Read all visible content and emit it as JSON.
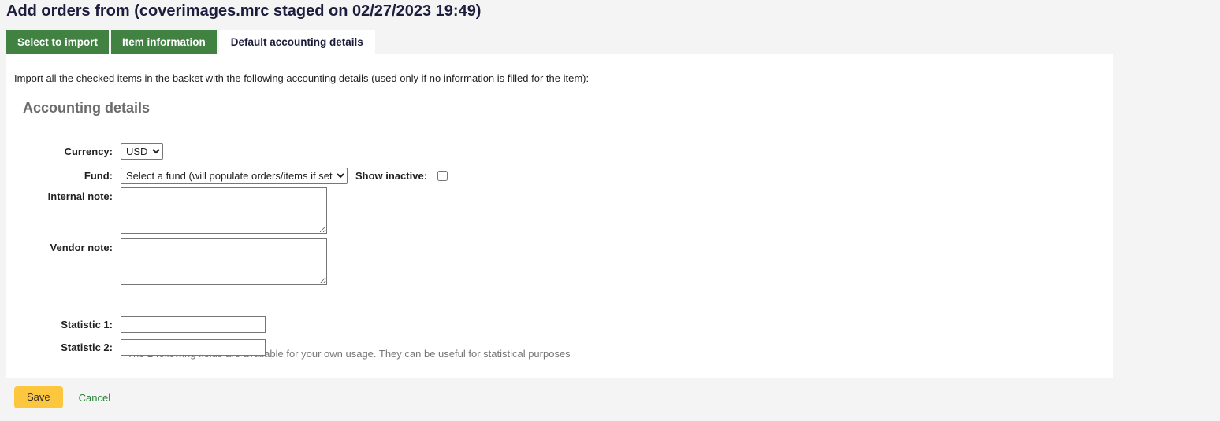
{
  "page": {
    "title": "Add orders from (coverimages.mrc staged on 02/27/2023 19:49)"
  },
  "tabs": [
    {
      "label": "Select to import",
      "active": false
    },
    {
      "label": "Item information",
      "active": false
    },
    {
      "label": "Default accounting details",
      "active": true
    }
  ],
  "content": {
    "intro": "Import all the checked items in the basket with the following accounting details (used only if no information is filled for the item):",
    "section_heading": "Accounting details",
    "hint": "The 2 following fields are available for your own usage. They can be useful for statistical purposes"
  },
  "form": {
    "currency": {
      "label": "Currency:",
      "value": "USD",
      "options": [
        "USD"
      ]
    },
    "fund": {
      "label": "Fund:",
      "value": "Select a fund (will populate orders/items if set)",
      "options": [
        "Select a fund (will populate orders/items if set)"
      ]
    },
    "show_inactive": {
      "label": "Show inactive:",
      "checked": false
    },
    "internal_note": {
      "label": "Internal note:",
      "value": "",
      "placeholder": ""
    },
    "vendor_note": {
      "label": "Vendor note:",
      "value": "",
      "placeholder": ""
    },
    "statistic_1": {
      "label": "Statistic 1:",
      "value": "",
      "placeholder": ""
    },
    "statistic_2": {
      "label": "Statistic 2:",
      "value": "",
      "placeholder": ""
    }
  },
  "actions": {
    "save_label": "Save",
    "cancel_label": "Cancel"
  },
  "colors": {
    "tab_green": "#418142",
    "save_yellow": "#fdc63f",
    "cancel_green": "#298338",
    "page_background": "#f4f4f4",
    "panel_background": "#ffffff",
    "heading_gray": "#6b6b6b",
    "hint_gray": "#767676"
  }
}
